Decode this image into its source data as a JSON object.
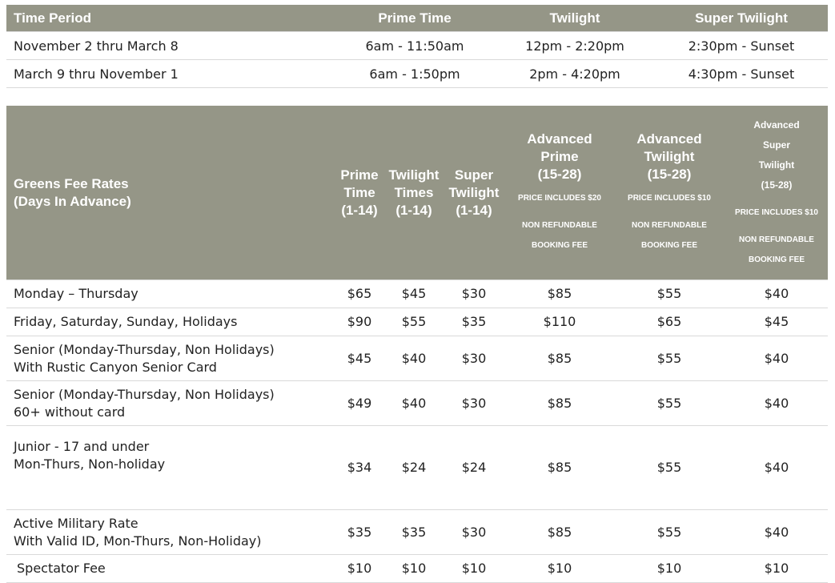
{
  "time_period": {
    "headers": [
      "Time Period",
      "Prime Time",
      "Twilight",
      "Super Twilight"
    ],
    "rows": [
      [
        "November 2 thru March 8",
        "6am - 11:50am",
        "12pm - 2:20pm",
        "2:30pm - Sunset"
      ],
      [
        "March 9 thru November 1",
        "6am - 1:50pm",
        "2pm - 4:20pm",
        "4:30pm - Sunset"
      ]
    ]
  },
  "rates": {
    "headers": {
      "col0": [
        "Greens Fee Rates",
        "(Days In Advance)"
      ],
      "col1": [
        "Prime",
        "Time",
        "(1-14)"
      ],
      "col2": [
        "Twilight",
        "Times",
        "(1-14)"
      ],
      "col3": [
        "Super",
        "Twilight",
        "(1-14)"
      ],
      "col4": [
        "Advanced",
        "Prime",
        "(15-28)",
        "PRICE INCLUDES $20",
        "NON REFUNDABLE",
        "BOOKING FEE"
      ],
      "col5": [
        "Advanced",
        "Twilight",
        "(15-28)",
        "PRICE INCLUDES $10",
        "NON REFUNDABLE",
        "BOOKING FEE"
      ],
      "col6": [
        "Advanced",
        "Super",
        "Twilight",
        "(15-28)",
        "PRICE INCLUDES $10",
        "NON REFUNDABLE",
        "BOOKING FEE"
      ]
    },
    "rows": [
      {
        "label": [
          "Monday – Thursday"
        ],
        "values": [
          "$65",
          "$45",
          "$30",
          "$85",
          "$55",
          "$40"
        ]
      },
      {
        "label": [
          "Friday, Saturday, Sunday, Holidays"
        ],
        "values": [
          "$90",
          "$55",
          "$35",
          "$110",
          "$65",
          "$45"
        ]
      },
      {
        "label": [
          "Senior (Monday-Thursday, Non Holidays)",
          "With Rustic Canyon Senior Card"
        ],
        "values": [
          "$45",
          "$40",
          "$30",
          "$85",
          "$55",
          "$40"
        ]
      },
      {
        "label": [
          "Senior (Monday-Thursday, Non Holidays)",
          "60+ without card"
        ],
        "values": [
          "$49",
          "$40",
          "$30",
          "$85",
          "$55",
          "$40"
        ]
      },
      {
        "label": [
          "Junior - 17 and under",
          "Mon-Thurs, Non-holiday"
        ],
        "values": [
          "$34",
          "$24",
          "$24",
          "$85",
          "$55",
          "$40"
        ]
      },
      {
        "label": [
          "Active Military Rate",
          "With Valid ID, Mon-Thurs, Non-Holiday)"
        ],
        "values": [
          "$35",
          "$35",
          "$30",
          "$85",
          "$55",
          "$40"
        ]
      },
      {
        "label": [
          "Spectator Fee"
        ],
        "values": [
          "$10",
          "$10",
          "$10",
          "$10",
          "$10",
          "$10"
        ]
      }
    ]
  }
}
